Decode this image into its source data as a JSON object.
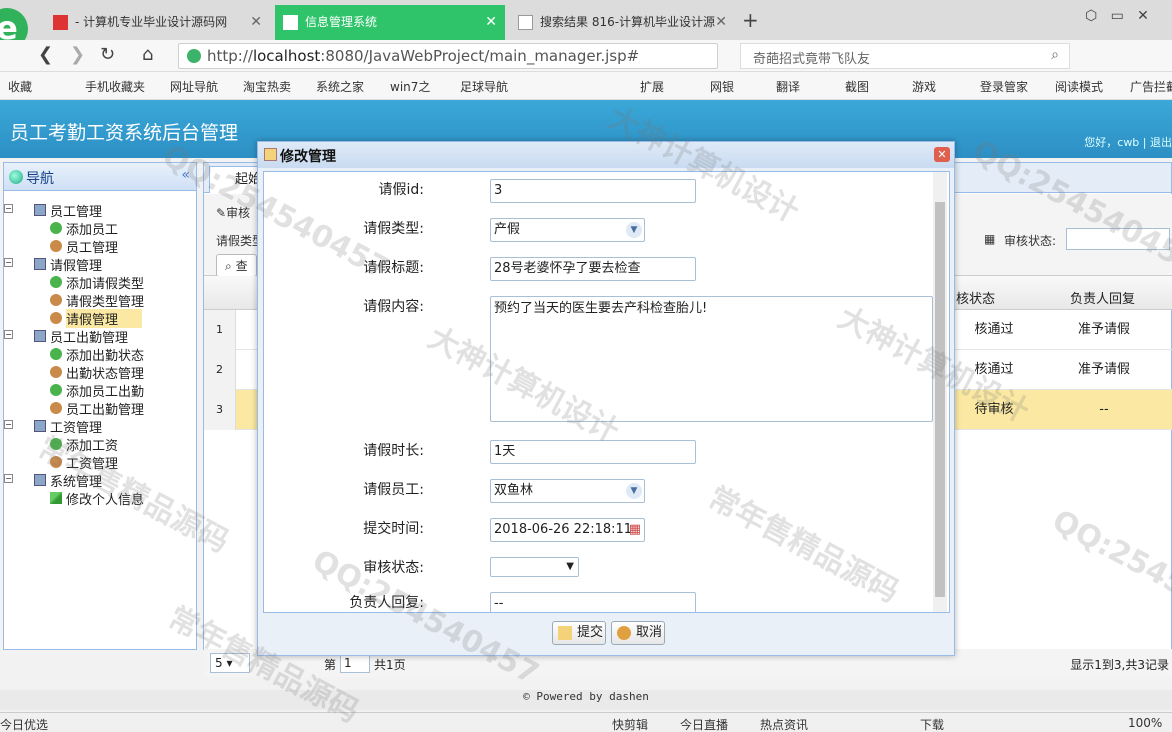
{
  "browser": {
    "tabs": [
      {
        "label": "- 计算机专业毕业设计源码网"
      },
      {
        "label": "信息管理系统"
      },
      {
        "label": "搜索结果 816-计算机毕业设计源"
      }
    ],
    "new_tab": "+",
    "url_prefix": "http://",
    "url_host": "localhost",
    "url_rest": ":8080/JavaWebProject/main_manager.jsp#",
    "search_hint": "奇葩招式竟带飞队友",
    "bookmarks": [
      "收藏",
      "手机收藏夹",
      "网址导航",
      "淘宝热卖",
      "系统之家",
      "win7之",
      "足球导航",
      "扩展",
      "网银",
      "翻译",
      "截图",
      "游戏",
      "登录管家",
      "阅读模式",
      "广告拦截"
    ]
  },
  "app": {
    "title": "员工考勤工资系统后台管理",
    "welcome": "您好，cwb | 退出",
    "nav_title": "导航",
    "nav_collapse": "«",
    "nav": [
      {
        "label": "员工管理",
        "level": 0,
        "icon": "computer-icon"
      },
      {
        "label": "添加员工",
        "level": 1,
        "icon": "add-icon"
      },
      {
        "label": "员工管理",
        "level": 1,
        "icon": "user-icon"
      },
      {
        "label": "请假管理",
        "level": 0,
        "icon": "computer-icon"
      },
      {
        "label": "添加请假类型",
        "level": 1,
        "icon": "add-icon"
      },
      {
        "label": "请假类型管理",
        "level": 1,
        "icon": "user-icon"
      },
      {
        "label": "请假管理",
        "level": 1,
        "icon": "user-icon",
        "selected": true
      },
      {
        "label": "员工出勤管理",
        "level": 0,
        "icon": "computer-icon"
      },
      {
        "label": "添加出勤状态",
        "level": 1,
        "icon": "add-icon"
      },
      {
        "label": "出勤状态管理",
        "level": 1,
        "icon": "user-icon"
      },
      {
        "label": "添加员工出勤",
        "level": 1,
        "icon": "add-icon"
      },
      {
        "label": "员工出勤管理",
        "level": 1,
        "icon": "user-icon"
      },
      {
        "label": "工资管理",
        "level": 0,
        "icon": "computer-icon"
      },
      {
        "label": "添加工资",
        "level": 1,
        "icon": "add-icon"
      },
      {
        "label": "工资管理",
        "level": 1,
        "icon": "user-icon"
      },
      {
        "label": "系统管理",
        "level": 0,
        "icon": "computer-icon"
      },
      {
        "label": "修改个人信息",
        "level": 1,
        "icon": "pencil-icon"
      }
    ],
    "main_tab": "起始",
    "toolbar": {
      "audit_button": "审核",
      "type_label": "请假类型",
      "query_button": "查",
      "audit_status_label": "审核状态:"
    },
    "grid": {
      "headers": [
        "核状态",
        "负责人回复"
      ],
      "rows": [
        {
          "num": "1",
          "status": "核通过",
          "reply": "准予请假"
        },
        {
          "num": "2",
          "status": "核通过",
          "reply": "准予请假"
        },
        {
          "num": "3",
          "status": "待审核",
          "reply": "--"
        }
      ]
    },
    "pager": {
      "page_size": "5",
      "page_prefix": "第",
      "page_value": "1",
      "page_total": "共1页",
      "summary": "显示1到3,共3记录"
    },
    "footer": "© Powered by dashen"
  },
  "modal": {
    "title": "修改管理",
    "fields": {
      "id_label": "请假id:",
      "id_value": "3",
      "type_label": "请假类型:",
      "type_value": "产假",
      "title_label": "请假标题:",
      "title_value": "28号老婆怀孕了要去检查",
      "content_label": "请假内容:",
      "content_value": "预约了当天的医生要去产科检查胎儿!",
      "duration_label": "请假时长:",
      "duration_value": "1天",
      "employee_label": "请假员工:",
      "employee_value": "双鱼林",
      "submit_time_label": "提交时间:",
      "submit_time_value": "2018-06-26 22:18:11",
      "audit_label": "审核状态:",
      "audit_value": "",
      "reply_label": "负责人回复:",
      "reply_value": "--"
    },
    "submit_button": "提交",
    "cancel_button": "取消"
  },
  "statusbar": {
    "left": "今日优选",
    "items": [
      "快剪辑",
      "今日直播",
      "热点资讯",
      "下载",
      "100%"
    ]
  },
  "watermarks": [
    "QQ:254540457",
    "大神计算机设计",
    "常年售精品源码"
  ]
}
